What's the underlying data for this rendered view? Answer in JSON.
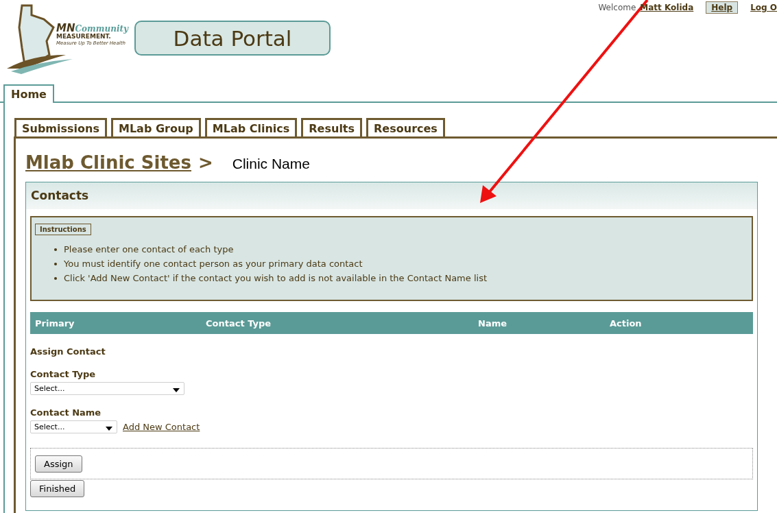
{
  "logo": {
    "mn": "MN",
    "community": "Community",
    "measurement": "MEASUREMENT.",
    "tagline": "Measure Up To Better Health"
  },
  "portal_title": "Data Portal",
  "user_bar": {
    "welcome": "Welcome",
    "user": "Matt Kolida",
    "help": "Help",
    "logout": "Log O"
  },
  "top_tabs": [
    {
      "label": "Home",
      "selected": true
    }
  ],
  "tabs": [
    {
      "label": "Submissions",
      "selected": false
    },
    {
      "label": "MLab Group",
      "selected": false
    },
    {
      "label": "MLab Clinics",
      "selected": false
    },
    {
      "label": "Results",
      "selected": false
    },
    {
      "label": "Resources",
      "selected": false
    }
  ],
  "breadcrumb": {
    "link": "Mlab Clinic Sites",
    "separator": ">",
    "current": "Clinic Name"
  },
  "panel": {
    "title": "Contacts",
    "instructions": {
      "label": "Instructions",
      "items": [
        "Please enter one contact of each type",
        "You must identify one contact person as your primary data contact",
        "Click 'Add New Contact' if the contact you wish to add is not available in the Contact Name list"
      ]
    },
    "table": {
      "columns": [
        "Primary",
        "Contact Type",
        "Name",
        "Action"
      ]
    },
    "form": {
      "title": "Assign Contact",
      "contact_type": {
        "label": "Contact Type",
        "value": "Select..."
      },
      "contact_name": {
        "label": "Contact Name",
        "value": "Select..."
      },
      "add_link": "Add New Contact",
      "assign": "Assign",
      "finished": "Finished"
    }
  }
}
